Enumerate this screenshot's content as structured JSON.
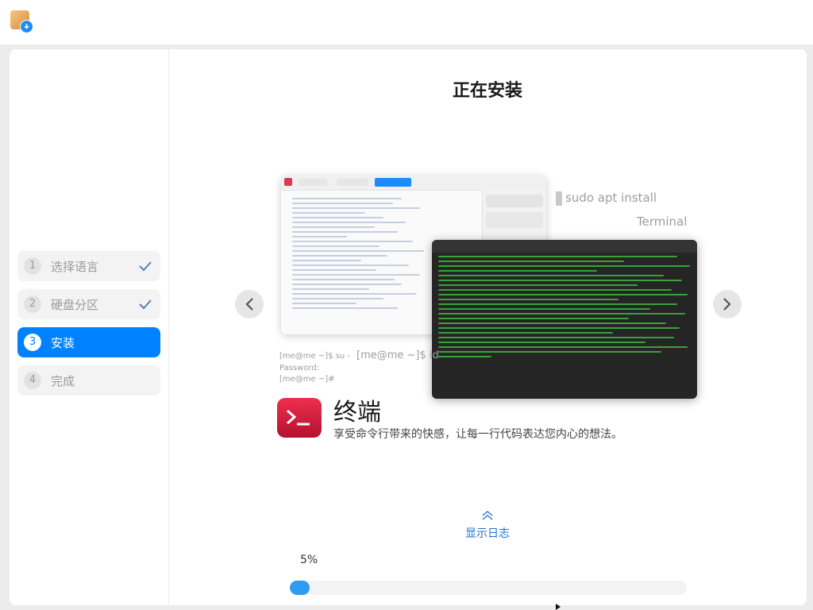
{
  "sidebar": {
    "steps": [
      {
        "num": "1",
        "label": "选择语言"
      },
      {
        "num": "2",
        "label": "硬盘分区"
      },
      {
        "num": "3",
        "label": "安装"
      },
      {
        "num": "4",
        "label": "完成"
      }
    ]
  },
  "main": {
    "title": "正在安装",
    "slide": {
      "caption_command": "sudo apt install",
      "caption_terminal": "Terminal",
      "prompt_su": "[me@me ~]$ su -",
      "prompt_password": "Password:",
      "prompt_root": "[me@me ~]#",
      "prompt_id": "[me@me ~]$ id",
      "feature_title": "终端",
      "feature_desc": "享受命令行带来的快感，让每一行代码表达您内心的想法。"
    },
    "show_log_label": "显示日志",
    "progress": {
      "value": 5,
      "label": "5%"
    }
  },
  "colors": {
    "accent": "#0081ff",
    "progress": "#2e9bf2",
    "terminal_red": "#e02848"
  },
  "icons": [
    "installer-app-icon",
    "checkmark-icon",
    "chevron-left-icon",
    "chevron-right-icon",
    "terminal-app-icon",
    "double-chevron-up-icon",
    "mouse-cursor-icon"
  ]
}
